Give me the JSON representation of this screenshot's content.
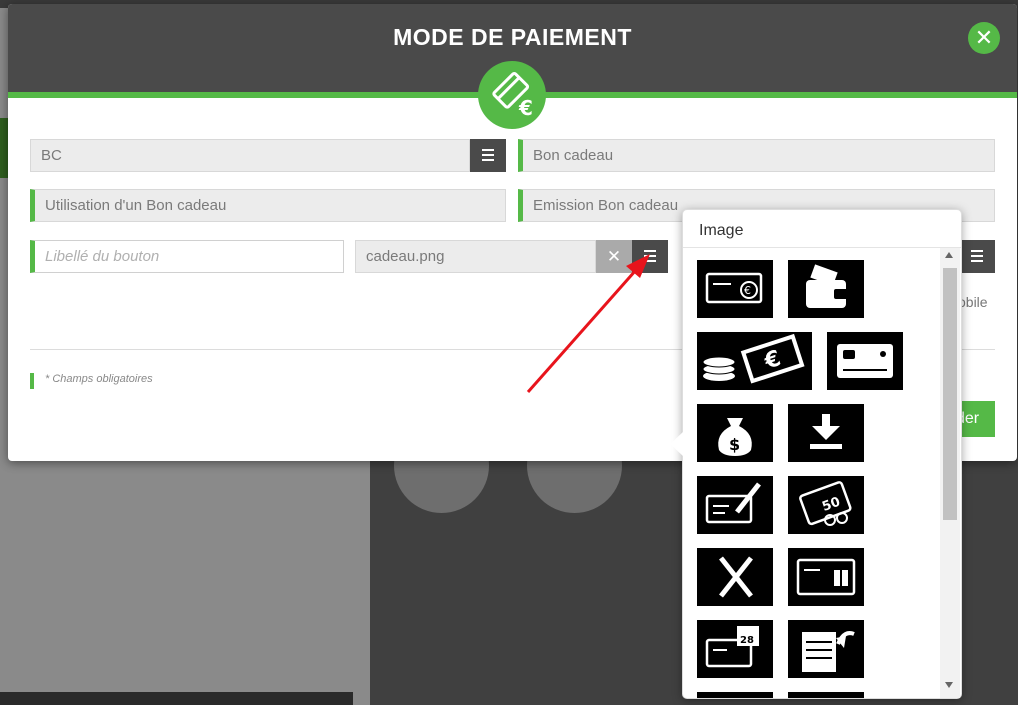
{
  "modal": {
    "title": "MODE DE PAIEMENT",
    "close_icon": "close-icon",
    "badge_icon": "card-euro-icon"
  },
  "form": {
    "code": {
      "value": "BC"
    },
    "label": {
      "value": "Bon cadeau"
    },
    "usage": {
      "value": "Utilisation d'un Bon cadeau"
    },
    "emission": {
      "value": "Emission Bon cadeau"
    },
    "button_label": {
      "placeholder": "Libellé du bouton"
    },
    "image": {
      "value": "cadeau.png"
    },
    "required_note": "* Champs obligatoires",
    "mobile_text": "obile",
    "action_button_text": "der"
  },
  "image_picker": {
    "title": "Image",
    "icons": [
      "check-euro-icon",
      "wallet-icon",
      "coins-banknote-icon",
      "credit-card-icon",
      "money-bag-icon",
      "download-icon",
      "check-signature-icon",
      "coupons-icon",
      "restaurant-icon",
      "gift-card-icon",
      "calendar-check-icon",
      "note-return-icon"
    ]
  },
  "colors": {
    "accent": "#55b947",
    "header": "#4a4a4a"
  }
}
